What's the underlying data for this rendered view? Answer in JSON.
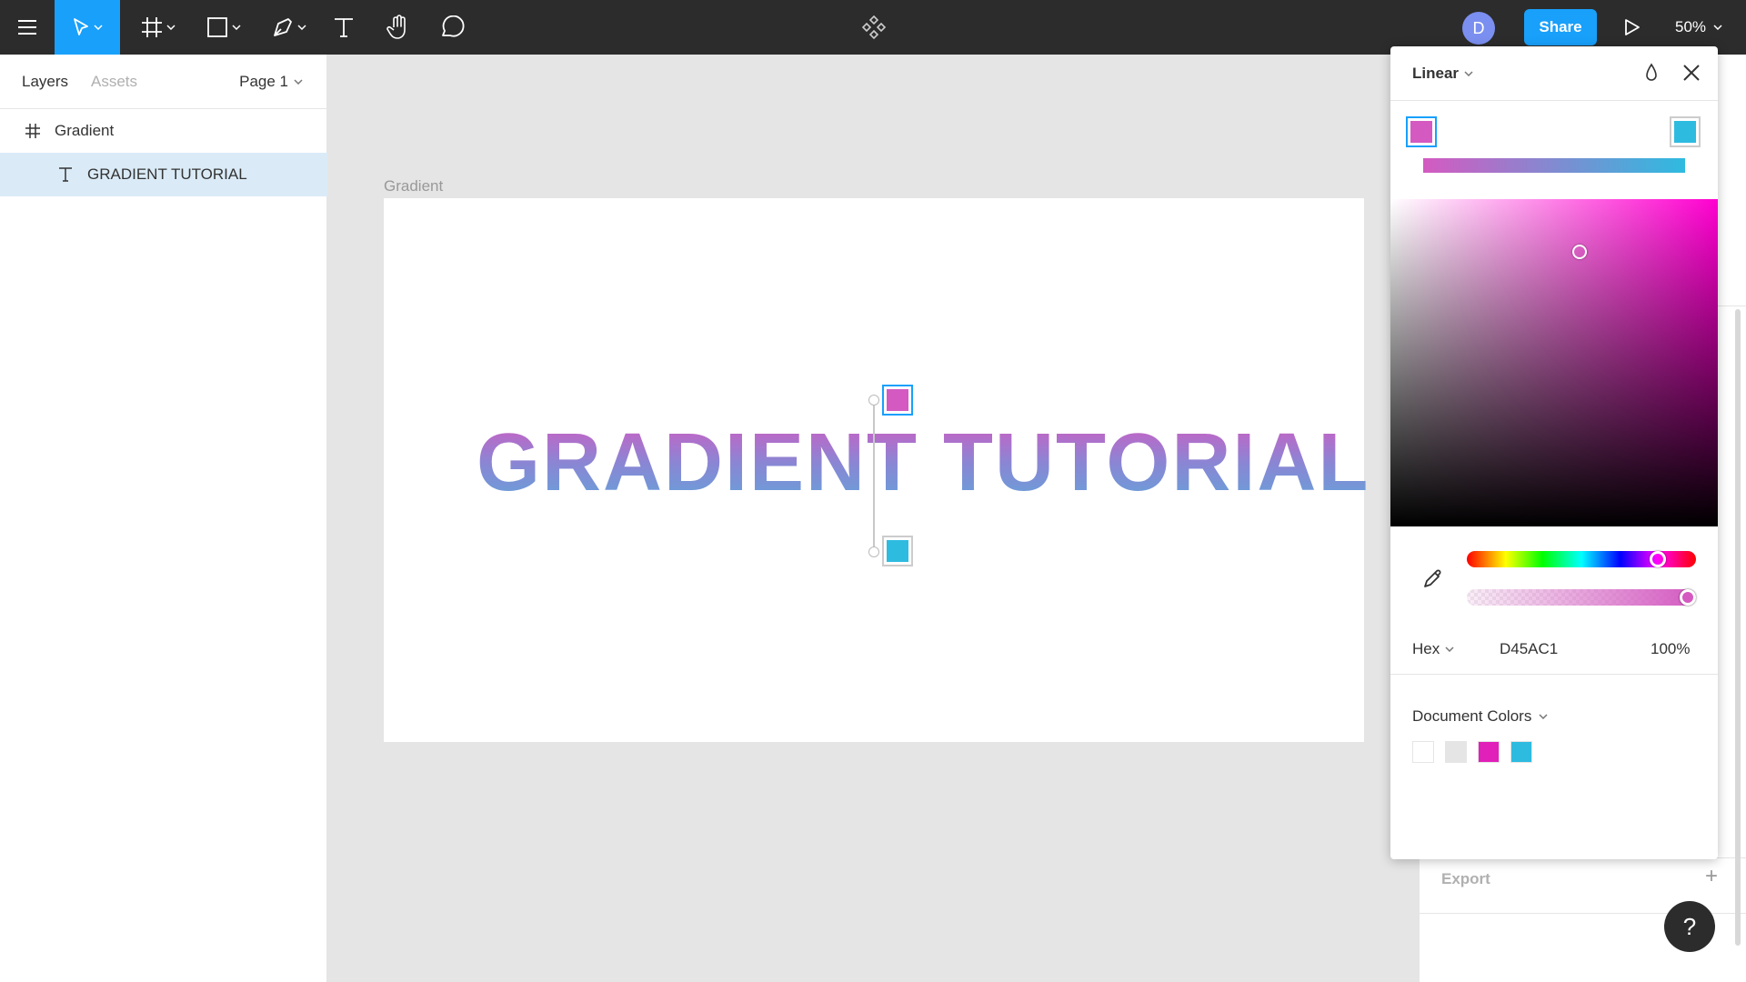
{
  "toolbar": {
    "avatar_initial": "D",
    "share_label": "Share",
    "zoom": "50%"
  },
  "layers_panel": {
    "tabs": [
      "Layers",
      "Assets"
    ],
    "page_selector": "Page 1",
    "layers": [
      {
        "name": "Gradient",
        "type": "frame-icon"
      },
      {
        "name": "GRADIENT TUTORIAL",
        "type": "text-icon",
        "selected": true
      }
    ]
  },
  "canvas": {
    "frame_label": "Gradient",
    "text_content": "GRADIENT TUTORIAL",
    "gradient_stops": [
      "#d45ac1",
      "#2ebbe0"
    ]
  },
  "color_picker": {
    "mode": "Linear",
    "format": "Hex",
    "hex_value": "D45AC1",
    "opacity": "100%",
    "document_colors_label": "Document Colors",
    "document_colors": [
      "#ffffff",
      "#e5e5e5",
      "#e020b8",
      "#2ebbe0"
    ],
    "hue_fraction": 0.83,
    "alpha_fraction": 1.0
  },
  "properties_panel": {
    "export_label": "Export"
  },
  "help_label": "?"
}
